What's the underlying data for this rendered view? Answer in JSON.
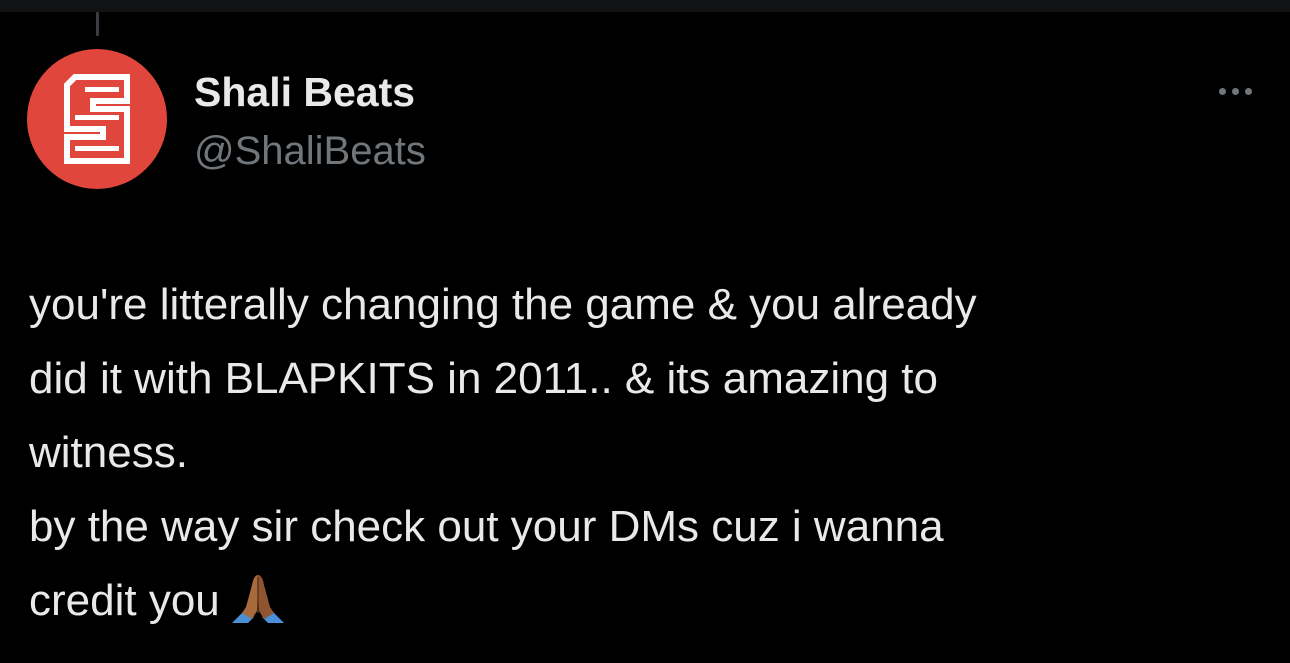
{
  "tweet": {
    "author": {
      "display_name": "Shali Beats",
      "handle": "@ShaliBeats",
      "avatar_icon": "red-circle-s-logo-icon",
      "avatar_color": "#e0463c"
    },
    "menu_icon": "more-options-icon",
    "text_lines": [
      "you're litterally changing the game & you already",
      "did it with BLAPKITS in 2011.. & its amazing to",
      "witness.",
      "by the way sir check out your DMs cuz i wanna",
      "credit you"
    ],
    "trailing_emoji": "folded-hands-emoji"
  },
  "theme": {
    "background": "#000000",
    "text": "#e7e9ea",
    "secondary_text": "#71767b"
  }
}
